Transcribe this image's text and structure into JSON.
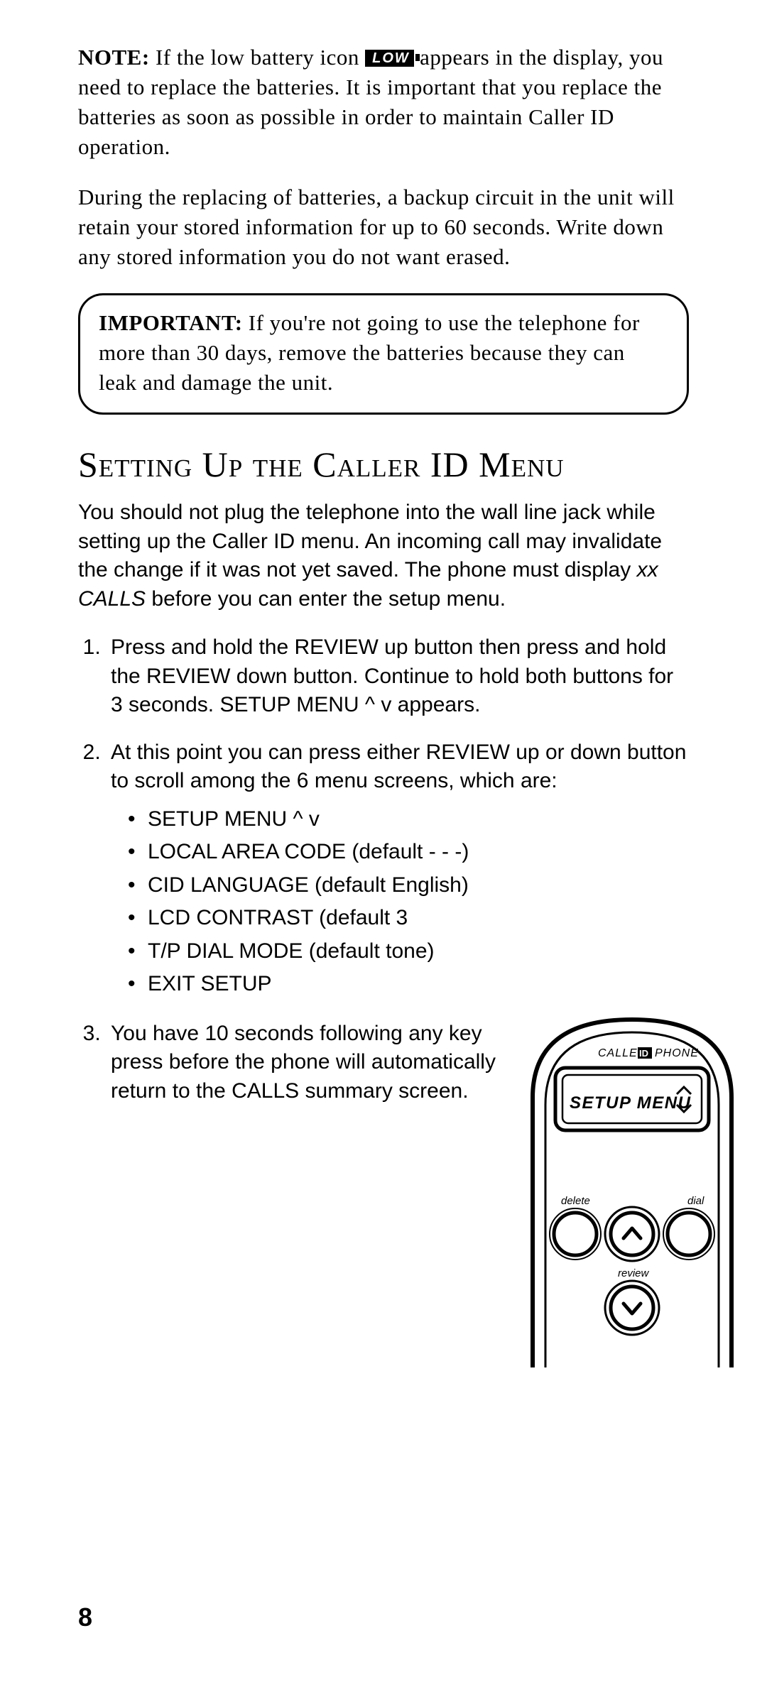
{
  "note": {
    "label": "NOTE:",
    "before_icon": " If the low battery icon ",
    "icon_text": "LOW",
    "after_icon": " appears in the display, you need to replace the batteries. It is important that you replace the batteries as soon as possible in order to maintain Caller ID operation."
  },
  "battery_para": "During the replacing of batteries, a backup circuit in the unit will retain your stored information for up to 60 seconds. Write down any stored information you do not want erased.",
  "important": {
    "label": "IMPORTANT:",
    "text": " If you're not going to use the telephone for more than 30 days, remove the batteries because they can leak and damage the unit."
  },
  "section_heading": "Setting Up the Caller ID Menu",
  "intro_para_a": "You should not plug the telephone into the wall line jack while setting up the Caller ID menu. An incoming call may invalidate the change if it was not yet saved. The phone must display ",
  "intro_para_ital": "xx CALLS",
  "intro_para_b": " before you can enter the setup menu.",
  "steps": {
    "s1_a": "Press and hold the REVIEW up button then press and hold the REVIEW down button. Continue to hold both buttons for 3 seconds. ",
    "s1_ital": "SETUP MENU ^ v",
    "s1_b": " appears.",
    "s2": "At this point you can press either REVIEW up or down button to scroll among the 6 menu screens, which are:",
    "bullets": [
      "SETUP MENU ^ v",
      "LOCAL AREA CODE (default - - -)",
      "CID LANGUAGE (default English)",
      "LCD CONTRAST (default 3",
      "T/P DIAL MODE (default tone)",
      "EXIT SETUP"
    ],
    "s3_a": "You have 10 seconds following any key press before the phone will automatically return to the ",
    "s3_ital": "CALLS",
    "s3_b": " summary screen."
  },
  "phone": {
    "brand_left": "CALLER",
    "brand_box": "ID",
    "brand_right": "PHONE",
    "lcd_text": "SETUP MENU",
    "label_delete": "delete",
    "label_dial": "dial",
    "label_review": "review"
  },
  "page_number": "8"
}
